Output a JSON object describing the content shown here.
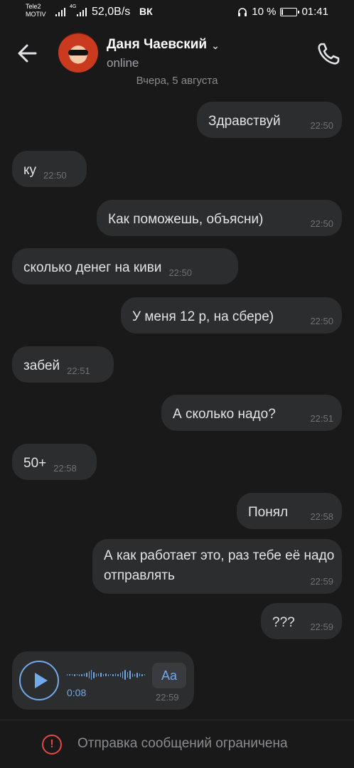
{
  "status_bar": {
    "carrier_line1": "Tele2",
    "carrier_line2": "MOTIV",
    "network_type": "4G",
    "speed": "52,0B/s",
    "vk_logo": "ВК",
    "battery": "10 %",
    "battery_level": 0.1,
    "time": "01:41"
  },
  "header": {
    "name": "Даня Чаевский",
    "status": "online",
    "icons": {
      "back": "arrow-left-icon",
      "call": "phone-icon",
      "dropdown": "chevron-down-icon"
    }
  },
  "date_separator": "Вчера, 5 августа",
  "messages": [
    {
      "direction": "out",
      "text": "Здравствуй",
      "time": "22:50"
    },
    {
      "direction": "in",
      "text": "ку",
      "time": "22:50"
    },
    {
      "direction": "out",
      "text": "Как поможешь, объясни)",
      "time": "22:50"
    },
    {
      "direction": "in",
      "text": "сколько денег на киви",
      "time": "22:50"
    },
    {
      "direction": "out",
      "text": "У меня 12 р, на сбере)",
      "time": "22:50"
    },
    {
      "direction": "in",
      "text": "забей",
      "time": "22:51"
    },
    {
      "direction": "out",
      "text": "А сколько надо?",
      "time": "22:51"
    },
    {
      "direction": "in",
      "text": "50+",
      "time": "22:58"
    },
    {
      "direction": "out",
      "text": "Понял",
      "time": "22:58"
    },
    {
      "direction": "out",
      "text": "А как работает это, раз тебе её надо отправлять",
      "time": "22:59"
    },
    {
      "direction": "out",
      "text": "???",
      "time": "22:59"
    }
  ],
  "voice_message": {
    "duration": "0:08",
    "transcribe_label": "Aa",
    "time": "22:59",
    "accent_color": "#71aaeb"
  },
  "bottom_bar": {
    "text": "Отправка сообщений ограничена",
    "warning_color": "#e64646"
  }
}
